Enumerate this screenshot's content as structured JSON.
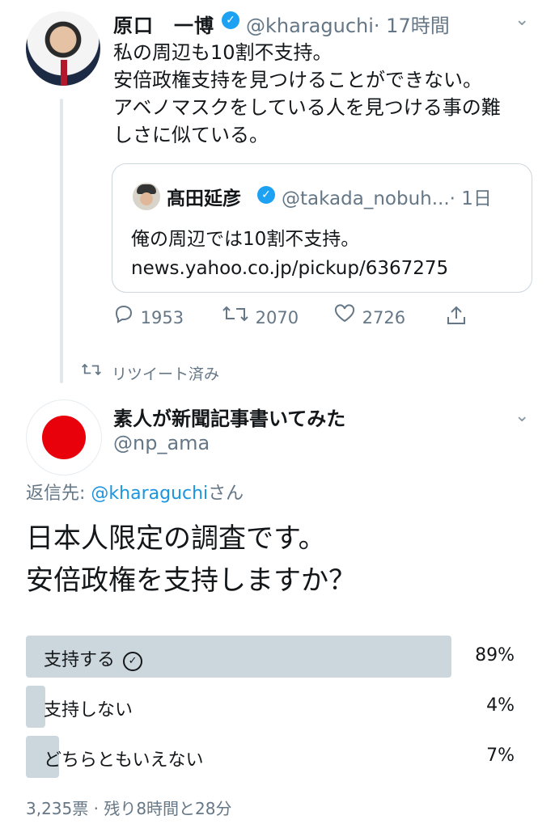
{
  "retweet_thread": {
    "author_name": "原口　一博",
    "handle": "@kharaguchi",
    "time": "· 17時間",
    "body_lines": [
      "私の周辺も10割不支持。",
      "安倍政権支持を見つけることができない。",
      "アベノマスクをしている人を見つける事の難",
      "しさに似ている。"
    ],
    "quoted": {
      "author_name": "髙田延彦",
      "handle": "@takada_nobuh...",
      "time": "· 1日",
      "text_line1": "俺の周辺では10割不支持。",
      "text_line2": "news.yahoo.co.jp/pickup/6367275"
    },
    "actions": {
      "reply_count": "1953",
      "retweet_count": "2070",
      "like_count": "2726"
    }
  },
  "retweeted_label": "リツイート済み",
  "main_tweet": {
    "author_name": "素人が新聞記事書いてみた",
    "handle": "@np_ama",
    "reply_prefix": "返信先: ",
    "reply_mention": "@kharaguchi",
    "reply_suffix": "さん",
    "question_lines": [
      "日本人限定の調査です。",
      "安倍政権を支持しますか？"
    ],
    "poll": {
      "options": [
        {
          "label": "支持する",
          "percent": "89%",
          "value": 89,
          "selected": true
        },
        {
          "label": "支持しない",
          "percent": "4%",
          "value": 4,
          "selected": false
        },
        {
          "label": "どちらともいえない",
          "percent": "7%",
          "value": 7,
          "selected": false
        }
      ],
      "meta": "3,235票 · 残り8時間と28分"
    }
  },
  "colors": {
    "accent": "#1da1f2",
    "link": "#1b95e0",
    "muted": "#657786",
    "poll_bar": "#ccd6dd",
    "flag_red": "#e8000b"
  },
  "icons": [
    "verified-icon",
    "chevron-down-icon",
    "reply-icon",
    "retweet-icon",
    "like-icon",
    "share-icon",
    "check-circle-icon"
  ]
}
